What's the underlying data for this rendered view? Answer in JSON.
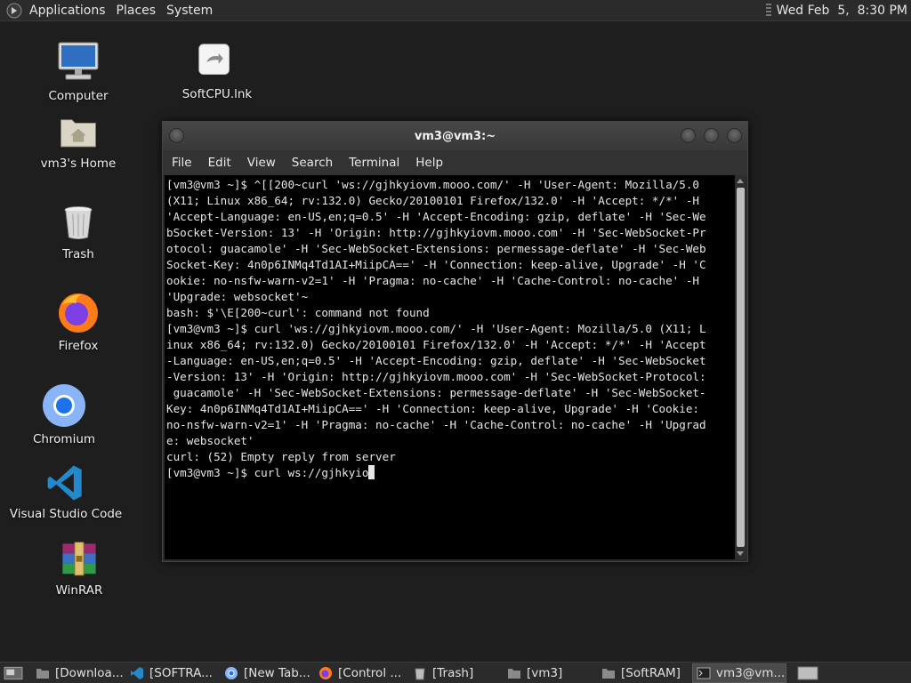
{
  "top_panel": {
    "menus": [
      "Applications",
      "Places",
      "System"
    ],
    "clock": "Wed Feb  5,  8:30 PM"
  },
  "desktop_icons": [
    {
      "label": "Computer",
      "icon": "computer-icon"
    },
    {
      "label": "SoftCPU.lnk",
      "icon": "shortcut-icon"
    },
    {
      "label": "vm3's Home",
      "icon": "home-folder-icon"
    },
    {
      "label": "Trash",
      "icon": "trash-icon"
    },
    {
      "label": "Firefox",
      "icon": "firefox-icon"
    },
    {
      "label": "Chromium",
      "icon": "chromium-icon"
    },
    {
      "label": "Visual Studio Code",
      "icon": "vscode-icon"
    },
    {
      "label": "WinRAR",
      "icon": "winrar-icon"
    }
  ],
  "terminal": {
    "title": "vm3@vm3:~",
    "menu": [
      "File",
      "Edit",
      "View",
      "Search",
      "Terminal",
      "Help"
    ],
    "lines": [
      "[vm3@vm3 ~]$ ^[[200~curl 'ws://gjhkyiovm.mooo.com/' -H 'User-Agent: Mozilla/5.0",
      "(X11; Linux x86_64; rv:132.0) Gecko/20100101 Firefox/132.0' -H 'Accept: */*' -H",
      "'Accept-Language: en-US,en;q=0.5' -H 'Accept-Encoding: gzip, deflate' -H 'Sec-We",
      "bSocket-Version: 13' -H 'Origin: http://gjhkyiovm.mooo.com' -H 'Sec-WebSocket-Pr",
      "otocol: guacamole' -H 'Sec-WebSocket-Extensions: permessage-deflate' -H 'Sec-Web",
      "Socket-Key: 4n0p6INMq4Td1AI+MiipCA==' -H 'Connection: keep-alive, Upgrade' -H 'C",
      "ookie: no-nsfw-warn-v2=1' -H 'Pragma: no-cache' -H 'Cache-Control: no-cache' -H",
      "'Upgrade: websocket'~",
      "bash: $'\\E[200~curl': command not found",
      "[vm3@vm3 ~]$ curl 'ws://gjhkyiovm.mooo.com/' -H 'User-Agent: Mozilla/5.0 (X11; L",
      "inux x86_64; rv:132.0) Gecko/20100101 Firefox/132.0' -H 'Accept: */*' -H 'Accept",
      "-Language: en-US,en;q=0.5' -H 'Accept-Encoding: gzip, deflate' -H 'Sec-WebSocket",
      "-Version: 13' -H 'Origin: http://gjhkyiovm.mooo.com' -H 'Sec-WebSocket-Protocol:",
      " guacamole' -H 'Sec-WebSocket-Extensions: permessage-deflate' -H 'Sec-WebSocket-",
      "Key: 4n0p6INMq4Td1AI+MiipCA==' -H 'Connection: keep-alive, Upgrade' -H 'Cookie:",
      "no-nsfw-warn-v2=1' -H 'Pragma: no-cache' -H 'Cache-Control: no-cache' -H 'Upgrad",
      "e: websocket'",
      "curl: (52) Empty reply from server"
    ],
    "current_input": "[vm3@vm3 ~]$ curl ws://gjhkyio"
  },
  "taskbar": {
    "items": [
      {
        "label": "[Downloa...",
        "icon": "folder-icon"
      },
      {
        "label": "[SOFTRA...",
        "icon": "vscode-icon"
      },
      {
        "label": "[New Tab...",
        "icon": "chromium-icon"
      },
      {
        "label": "[Control ...",
        "icon": "firefox-icon"
      },
      {
        "label": "[Trash]",
        "icon": "trash-icon"
      },
      {
        "label": "[vm3]",
        "icon": "folder-icon"
      },
      {
        "label": "[SoftRAM]",
        "icon": "folder-icon"
      },
      {
        "label": "vm3@vm...",
        "icon": "terminal-icon"
      }
    ]
  }
}
